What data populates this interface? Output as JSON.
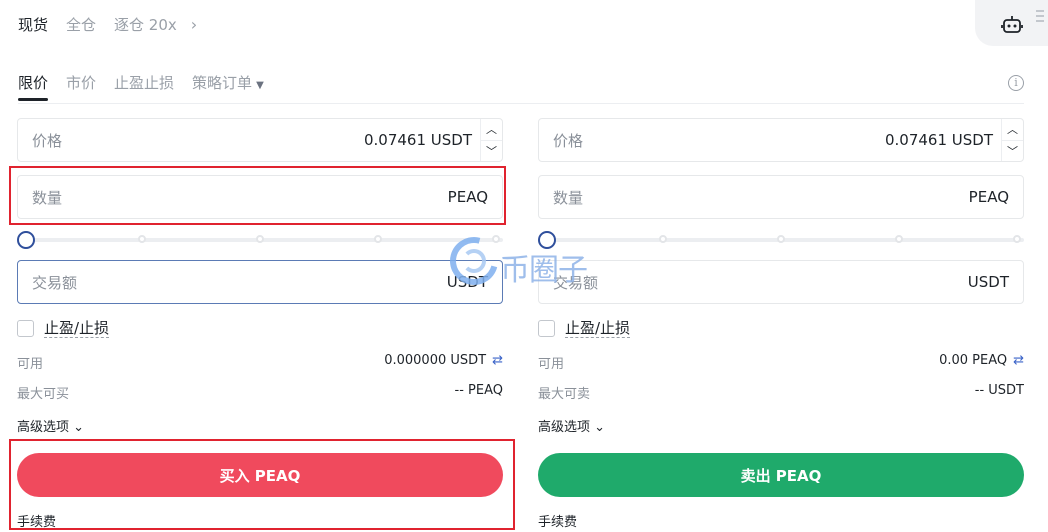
{
  "top_tabs": {
    "spot": "现货",
    "cross": "全仓",
    "isolated": "逐仓 20x"
  },
  "order_tabs": {
    "limit": "限价",
    "market": "市价",
    "tpsl": "止盈止损",
    "strategy": "策略订单"
  },
  "buy": {
    "price_label": "价格",
    "price_value": "0.07461 USDT",
    "qty_label": "数量",
    "qty_unit": "PEAQ",
    "amount_label": "交易额",
    "amount_unit": "USDT",
    "tpsl_label": "止盈/止损",
    "available_label": "可用",
    "available_value": "0.000000 USDT",
    "max_label": "最大可买",
    "max_value": "-- PEAQ",
    "advanced_label": "高级选项",
    "button_label": "买入 PEAQ",
    "fee_label": "手续费"
  },
  "sell": {
    "price_label": "价格",
    "price_value": "0.07461 USDT",
    "qty_label": "数量",
    "qty_unit": "PEAQ",
    "amount_label": "交易额",
    "amount_unit": "USDT",
    "tpsl_label": "止盈/止损",
    "available_label": "可用",
    "available_value": "0.00 PEAQ",
    "max_label": "最大可卖",
    "max_value": "-- USDT",
    "advanced_label": "高级选项",
    "button_label": "卖出 PEAQ",
    "fee_label": "手续费"
  },
  "watermark": "币圈子",
  "colors": {
    "buy": "#f04a5d",
    "sell": "#1faa6b",
    "highlight": "#e0232f",
    "accent": "#2f4f9c"
  },
  "icons": [
    "chevron-right-icon",
    "robot-icon",
    "menu-icon",
    "caret-down-icon",
    "info-icon",
    "chevron-up-icon",
    "chevron-down-icon",
    "swap-icon"
  ]
}
